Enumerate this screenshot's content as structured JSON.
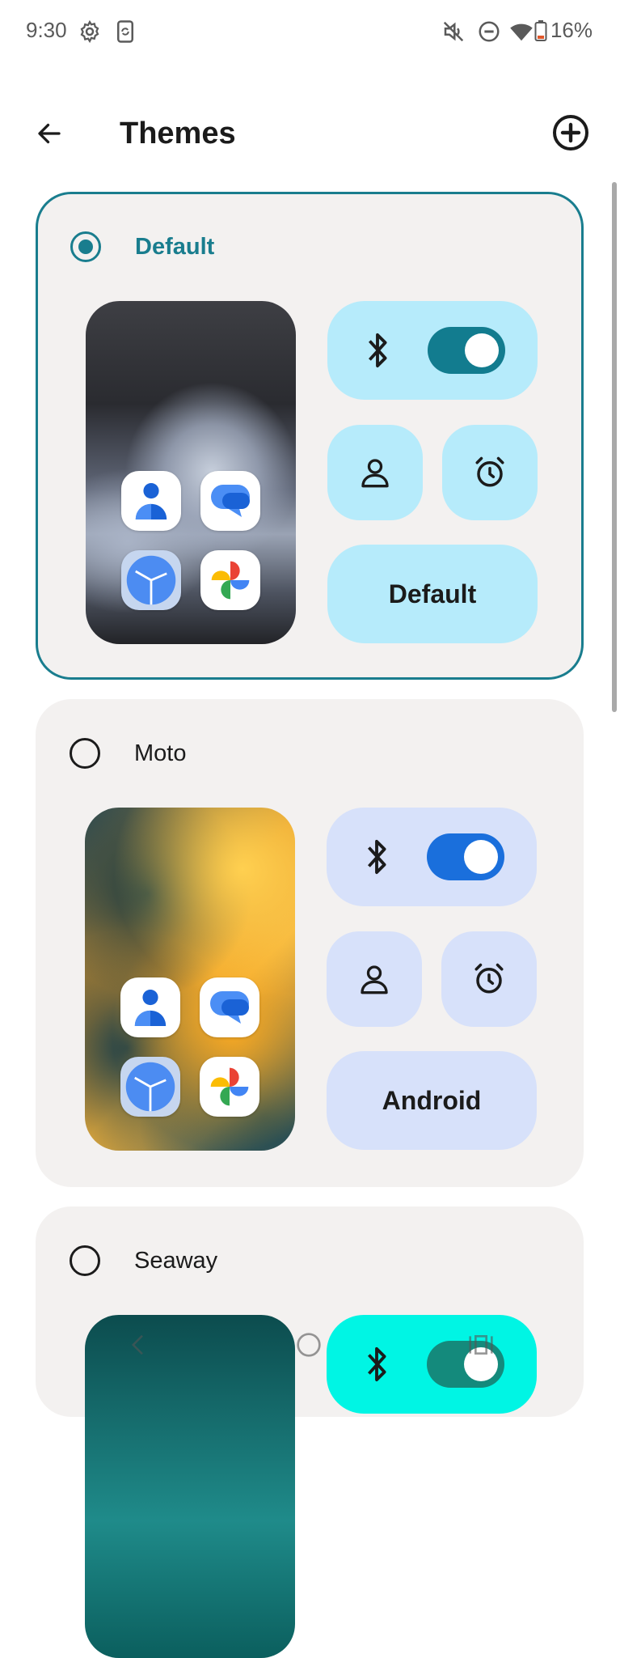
{
  "status_bar": {
    "time": "9:30",
    "battery": "16%",
    "icons": [
      "settings-gear-icon",
      "phone-sync-icon",
      "mute-icon",
      "do-not-disturb-icon",
      "wifi-icon",
      "battery-icon"
    ]
  },
  "app_bar": {
    "title": "Themes",
    "back_icon": "arrow-back-icon",
    "add_icon": "add-circle-icon"
  },
  "themes": [
    {
      "name": "Default",
      "selected": true,
      "tile_label": "Default",
      "tile_color": "#b6ebfb",
      "toggle_color": "#127c8f",
      "icons": [
        "contacts-icon",
        "messages-icon",
        "clock-icon",
        "photos-icon",
        "bluetooth-icon",
        "person-icon",
        "alarm-icon"
      ]
    },
    {
      "name": "Moto",
      "selected": false,
      "tile_label": "Android",
      "tile_color": "#d7e1fa",
      "toggle_color": "#1a6fdc",
      "icons": [
        "contacts-icon",
        "messages-icon",
        "clock-icon",
        "photos-icon",
        "bluetooth-icon",
        "person-icon",
        "alarm-icon"
      ]
    },
    {
      "name": "Seaway",
      "selected": false,
      "tile_color": "#00f5e4",
      "toggle_color": "#148a7c",
      "icons": [
        "bluetooth-icon"
      ]
    }
  ],
  "colors": {
    "accent": "#197d8e",
    "card_background": "#f3f1f0"
  }
}
